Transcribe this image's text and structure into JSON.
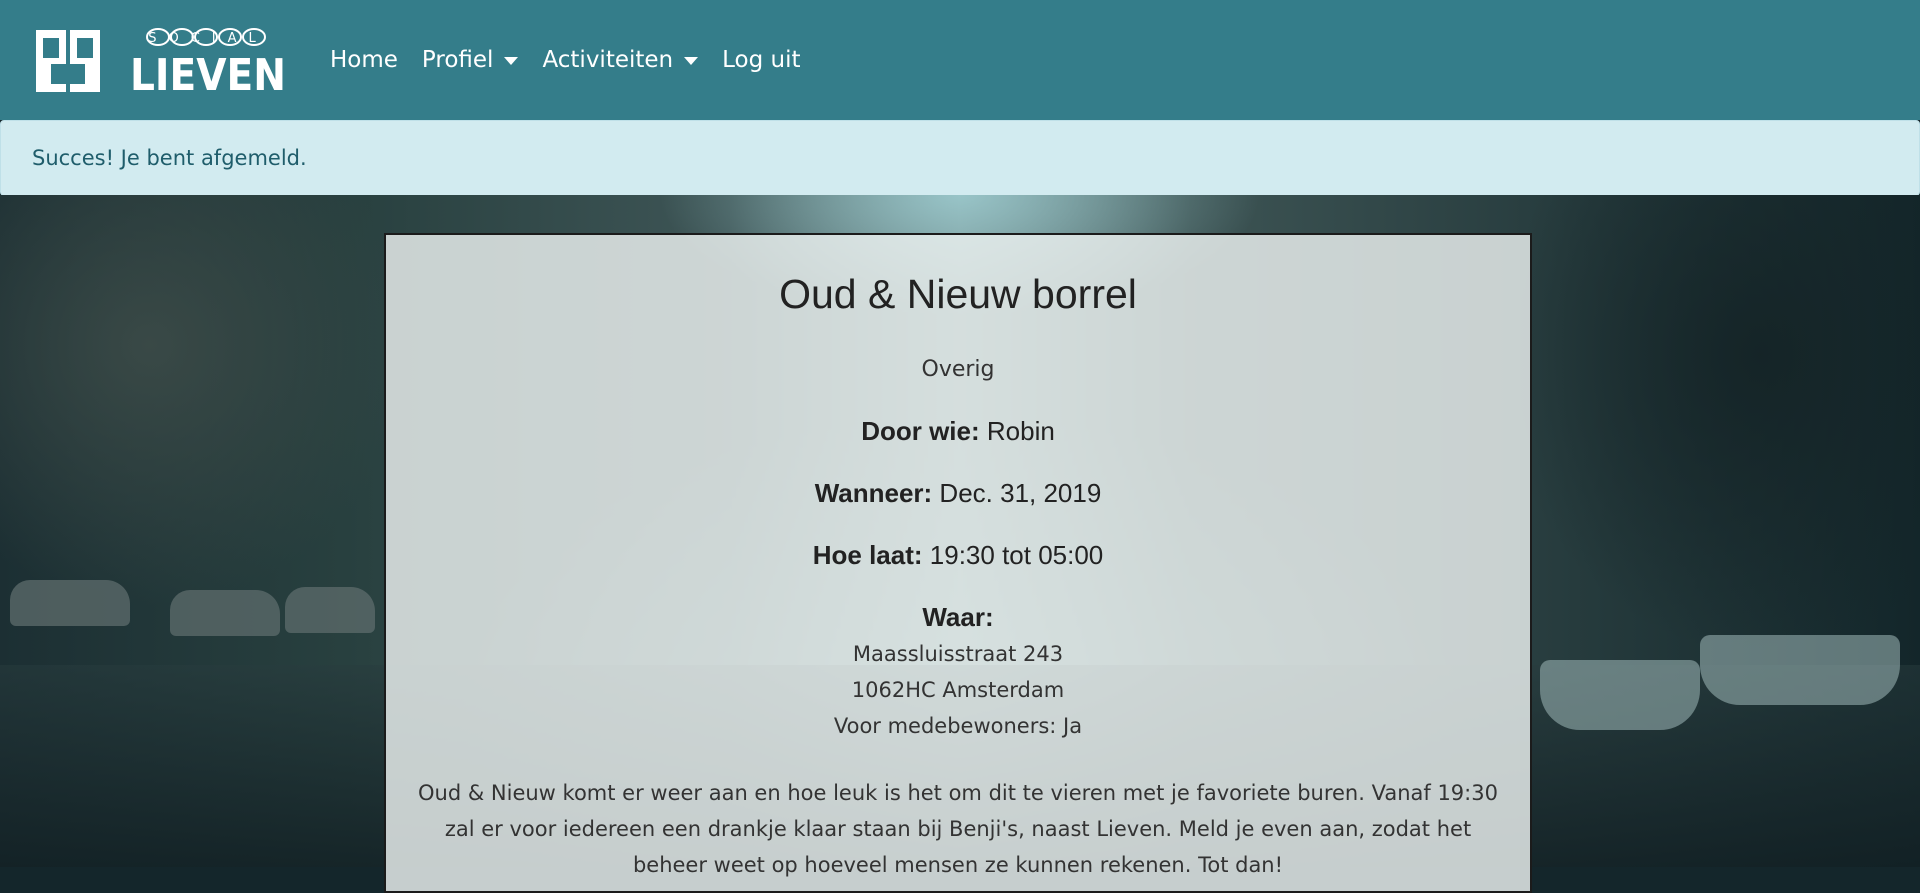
{
  "brand": {
    "logo_top_text": "SOCIAL",
    "logo_main_text": "LIEVEN"
  },
  "nav": {
    "items": [
      {
        "label": "Home",
        "dropdown": false
      },
      {
        "label": "Profiel",
        "dropdown": true
      },
      {
        "label": "Activiteiten",
        "dropdown": true
      },
      {
        "label": "Log uit",
        "dropdown": false
      }
    ]
  },
  "alert": {
    "text": "Succes! Je bent afgemeld."
  },
  "activity": {
    "title": "Oud & Nieuw borrel",
    "category": "Overig",
    "who_label": "Door wie:",
    "who_value": "Robin",
    "when_label": "Wanneer:",
    "when_value": "Dec. 31, 2019",
    "time_label": "Hoe laat:",
    "time_value": "19:30 tot 05:00",
    "where_label": "Waar:",
    "address_line1": "Maassluisstraat 243",
    "address_line2": "1062HC Amsterdam",
    "residents_only": "Voor medebewoners: Ja",
    "description": "Oud & Nieuw komt er weer aan en hoe leuk is het om dit te vieren met je favoriete buren. Vanaf 19:30 zal er voor iedereen een drankje klaar staan bij Benji's, naast Lieven. Meld je even aan, zodat het beheer weet op hoeveel mensen ze kunnen rekenen. Tot dan!"
  },
  "colors": {
    "navbar": "#347d8a",
    "alert_bg": "#d2ebf0",
    "alert_text": "#1f5d6b"
  }
}
